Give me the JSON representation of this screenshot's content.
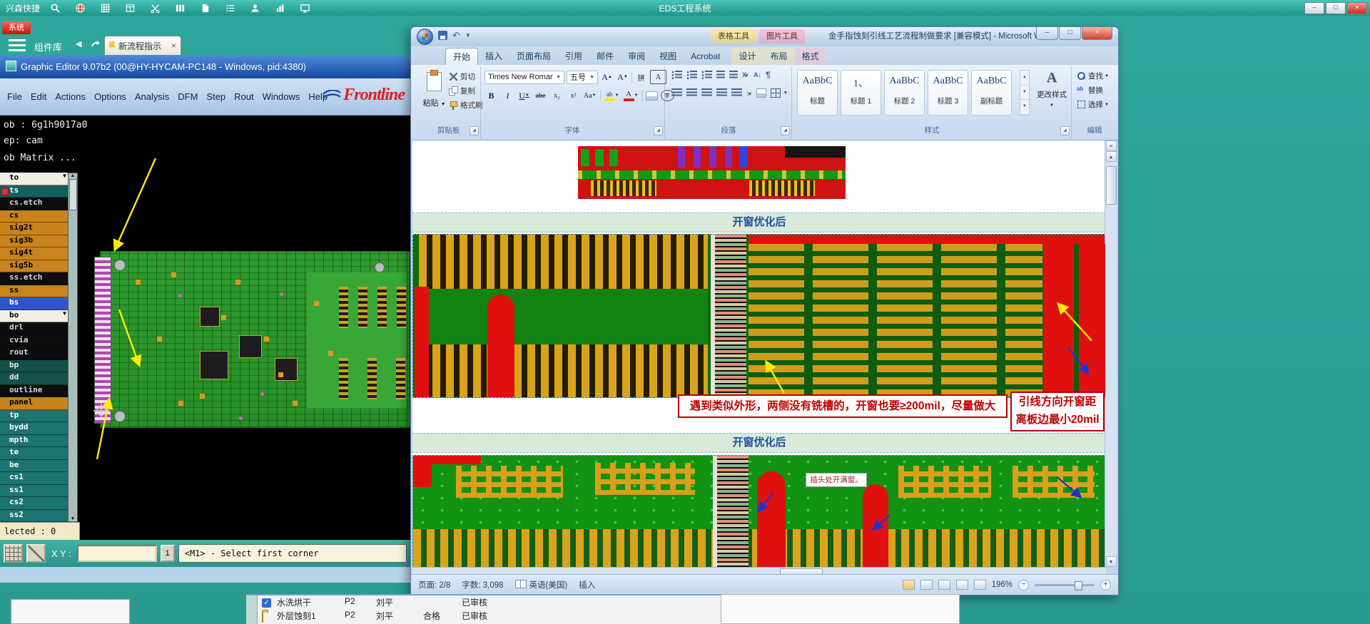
{
  "system_bar": {
    "app_label": "兴森快捷",
    "title": "EDS工程系统",
    "icons": [
      "search",
      "globe",
      "grid",
      "table",
      "scissors",
      "columns",
      "document",
      "list",
      "user",
      "chart",
      "monitor"
    ]
  },
  "cam": {
    "badge": "系统",
    "library_label": "组件库",
    "flow_tab": "新流程指示",
    "title": "Graphic Editor 9.07b2 (00@HY-HYCAM-PC148 - Windows, pid:4380)",
    "menus": [
      "File",
      "Edit",
      "Actions",
      "Options",
      "Analysis",
      "DFM",
      "Step",
      "Rout",
      "Windows",
      "Help"
    ],
    "logo": "Frontline",
    "job_lines": [
      "ob : 6g1h9017a0",
      "ep: cam",
      "ob Matrix ..."
    ],
    "layers": [
      {
        "name": "to",
        "bg": "#f2f0e4",
        "fg": "#000000",
        "arrow": true
      },
      {
        "name": "ts",
        "bg": "#15605c",
        "fg": "#ffffff",
        "chip": "#e03030"
      },
      {
        "name": "cs.etch",
        "bg": "#0d0d0d",
        "fg": "#d8d8d8"
      },
      {
        "name": "cs",
        "bg": "#c8831c",
        "fg": "#000000"
      },
      {
        "name": "sig2t",
        "bg": "#c8831c",
        "fg": "#000000"
      },
      {
        "name": "sig3b",
        "bg": "#c8831c",
        "fg": "#000000"
      },
      {
        "name": "sig4t",
        "bg": "#c8831c",
        "fg": "#000000"
      },
      {
        "name": "sig5b",
        "bg": "#c8831c",
        "fg": "#000000"
      },
      {
        "name": "ss.etch",
        "bg": "#0d0d0d",
        "fg": "#d8d8d8"
      },
      {
        "name": "ss",
        "bg": "#c8831c",
        "fg": "#000000"
      },
      {
        "name": "bs",
        "bg": "#2f55c8",
        "fg": "#ffffff"
      },
      {
        "name": "bo",
        "bg": "#f2f0e4",
        "fg": "#000000",
        "arrow": true
      },
      {
        "name": "drl",
        "bg": "#0d0d0d",
        "fg": "#d8d8d8"
      },
      {
        "name": "cvia",
        "bg": "#0d0d0d",
        "fg": "#d8d8d8"
      },
      {
        "name": "rout",
        "bg": "#0d0d0d",
        "fg": "#d8d8d8"
      },
      {
        "name": "bp",
        "bg": "#14504c",
        "fg": "#e8e8e8"
      },
      {
        "name": "dd",
        "bg": "#14504c",
        "fg": "#e8e8e8"
      },
      {
        "name": "outline",
        "bg": "#0d0d0d",
        "fg": "#d8d8d8"
      },
      {
        "name": "panel",
        "bg": "#c8831c",
        "fg": "#000000"
      },
      {
        "name": "tp",
        "bg": "#1c7370",
        "fg": "#ffffff"
      },
      {
        "name": "bydd",
        "bg": "#1c7370",
        "fg": "#ffffff"
      },
      {
        "name": "mpth",
        "bg": "#1c7370",
        "fg": "#ffffff"
      },
      {
        "name": "te",
        "bg": "#1c7370",
        "fg": "#ffffff"
      },
      {
        "name": "be",
        "bg": "#1c7370",
        "fg": "#ffffff"
      },
      {
        "name": "cs1",
        "bg": "#1c7370",
        "fg": "#ffffff"
      },
      {
        "name": "ss1",
        "bg": "#1c7370",
        "fg": "#ffffff"
      },
      {
        "name": "cs2",
        "bg": "#1c7370",
        "fg": "#ffffff"
      },
      {
        "name": "ss2",
        "bg": "#1c7370",
        "fg": "#ffffff"
      }
    ],
    "selected_label": "lected : 0",
    "xy_label": "X Y :",
    "xy_value": "",
    "mode_button": "1",
    "prompt": "<M1> - Select first corner"
  },
  "word": {
    "title": "金手指蚀刻引线工艺流程制做要求 [兼容模式] - Microsoft Word",
    "context_tools": {
      "table": "表格工具",
      "picture": "图片工具"
    },
    "tabs": [
      {
        "label": "开始",
        "state": "active"
      },
      {
        "label": "插入"
      },
      {
        "label": "页面布局"
      },
      {
        "label": "引用"
      },
      {
        "label": "邮件"
      },
      {
        "label": "审阅"
      },
      {
        "label": "视图"
      },
      {
        "label": "Acrobat"
      },
      {
        "label": "设计",
        "ctx": "table"
      },
      {
        "label": "布局",
        "ctx": "table"
      },
      {
        "label": "格式",
        "ctx": "picture"
      }
    ],
    "ribbon": {
      "clipboard": {
        "group_label": "剪贴板",
        "paste": "粘贴",
        "cut": "剪切",
        "copy": "复制",
        "format_painter": "格式刷"
      },
      "font": {
        "group_label": "字体",
        "family": "Times New Roman",
        "size": "五号"
      },
      "paragraph": {
        "group_label": "段落"
      },
      "styles": {
        "group_label": "样式",
        "change_styles": "更改样式",
        "items": [
          {
            "preview": "AaBbC",
            "label": "标题"
          },
          {
            "preview": "1、",
            "label": "标题 1"
          },
          {
            "preview": "AaBbC",
            "label": "标题 2"
          },
          {
            "preview": "AaBbC",
            "label": "标题 3"
          },
          {
            "preview": "AaBbC",
            "label": "副标题"
          }
        ]
      },
      "editing": {
        "group_label": "编辑",
        "find": "查找",
        "replace": "替换",
        "select": "选择"
      }
    },
    "document": {
      "heading1": "开窗优化后",
      "heading2": "开窗优化后",
      "note_wide": "遇到类似外形，两侧没有铣槽的，开窗也要≥200mil，尽量做大",
      "note_right_line1": "引线方向开窗距",
      "note_right_line2": "离板边最小20mil",
      "note_small": "插头处开满窗。"
    },
    "status": {
      "page": "页面: 2/8",
      "words": "字数: 3,098",
      "language": "英语(美国)",
      "insert_mode": "插入",
      "zoom": "196%"
    }
  },
  "background_window": {
    "rows": [
      {
        "icon": "check",
        "name": "水洗烘干",
        "station": "P2",
        "person": "刘平",
        "result": "",
        "status": "已审核"
      },
      {
        "icon": "folder",
        "name": "外层蚀刻1",
        "station": "P2",
        "person": "刘平",
        "result": "合格",
        "status": "已审核"
      }
    ]
  }
}
